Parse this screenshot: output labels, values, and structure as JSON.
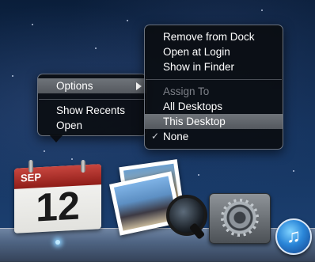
{
  "calendar_icon": {
    "month": "SEP",
    "day": "12"
  },
  "left_menu": {
    "items": [
      {
        "label": "Options"
      },
      {
        "label": "Show Recents"
      },
      {
        "label": "Open"
      }
    ]
  },
  "submenu": {
    "items": [
      {
        "label": "Remove from Dock"
      },
      {
        "label": "Open at Login"
      },
      {
        "label": "Show in Finder"
      }
    ],
    "assign_header": "Assign To",
    "assign_items": [
      {
        "label": "All Desktops"
      },
      {
        "label": "This Desktop"
      },
      {
        "label": "None"
      }
    ],
    "check_mark": "✓"
  },
  "itunes_glyph": "♫",
  "dock_apps": [
    "calendar-icon",
    "preview-icon",
    "system-preferences-icon",
    "itunes-icon"
  ],
  "colors": {
    "menu_highlight": "#62666c",
    "calendar_red": "#b3332c",
    "disabled_text": "#7d8088"
  }
}
